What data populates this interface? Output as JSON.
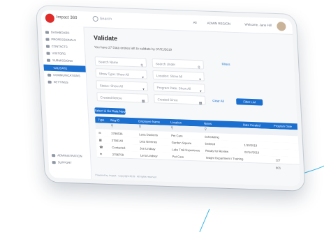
{
  "app": {
    "logo_text": "Impact 360",
    "search_placeholder": "Search"
  },
  "topbar": {
    "scope": "All",
    "org": "ADMIN REGION",
    "user": "Welcome, Jane Hill"
  },
  "sidebar": {
    "items": [
      {
        "label": "DASHBOARD",
        "active": false
      },
      {
        "label": "PROFESSIONALS",
        "active": false
      },
      {
        "label": "CONTACTS",
        "active": false
      },
      {
        "label": "VISITORS",
        "active": false
      },
      {
        "label": "SUBMISSIONS",
        "active": false
      },
      {
        "label": "VALIDATE",
        "active": true
      },
      {
        "label": "COMMUNICATIONS",
        "active": false
      },
      {
        "label": "SETTINGS",
        "active": false
      }
    ],
    "bottom": [
      "ADMINISTRATION",
      "SUPPORT"
    ]
  },
  "main": {
    "title": "Validate",
    "subtitle": "You have 27 Data entries left to validate by 07/01/2019",
    "filters": {
      "search_name": "Search Name",
      "search_user": "Search Under",
      "show_type": "Show Type: Show All",
      "location": "Location: Show All",
      "status": "Status: Show All",
      "program": "Program Date: Show All",
      "created_before": "Created Before",
      "created_since": "Created Since",
      "filters_link": "Filters",
      "clear_all": "Clear All",
      "filter_list": "Filter List"
    },
    "select_all_button": "Select & Go Data Now",
    "table": {
      "headers": [
        "Type",
        "Reg ID",
        "Employee Name",
        "Location",
        "Notes",
        "Date Created",
        "Program Date"
      ],
      "rows": [
        [
          "",
          "2786536",
          "Lena Dockens",
          "Pet Care",
          "Scheduling",
          "",
          ""
        ],
        [
          "",
          "2786140",
          "Leta Greeney",
          "Garden Square",
          "Deleted",
          "1/10/2019",
          ""
        ],
        [
          "",
          "Contacted",
          "Joe Lindsay",
          "Lake Trail Experience",
          "Ready for Review",
          "02/14/2019",
          ""
        ],
        [
          "",
          "2786708",
          "Lena Lindsey",
          "Pet Care",
          "Insight Department / Training",
          "",
          "127"
        ]
      ],
      "extra": "801"
    },
    "footer": "Powered by Impact · Copyright 2019 · All rights reserved"
  }
}
